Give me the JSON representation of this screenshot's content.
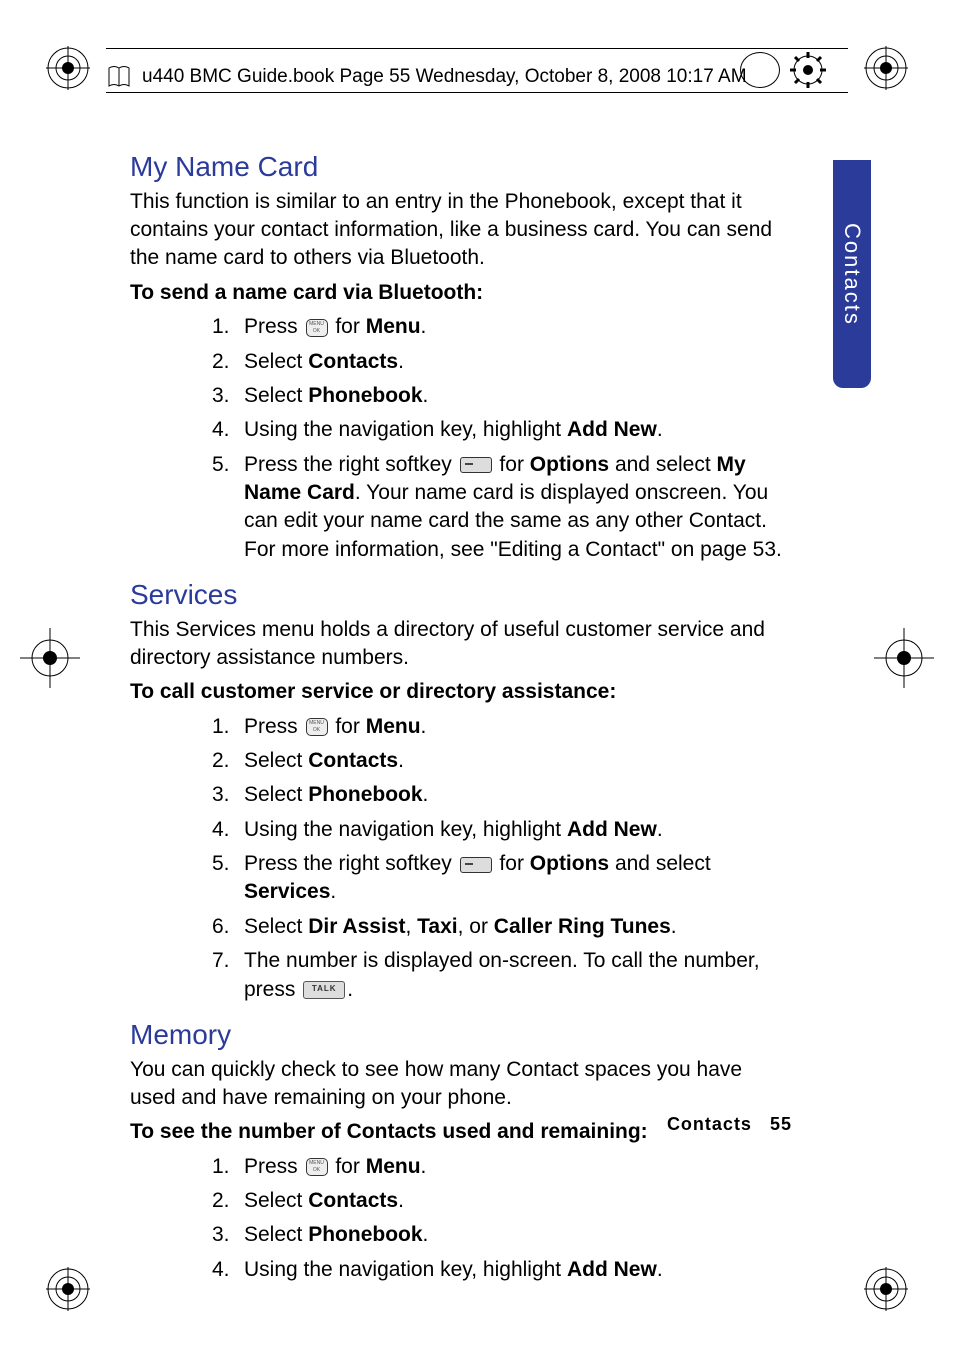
{
  "header": {
    "text": "u440 BMC Guide.book  Page 55  Wednesday, October 8, 2008  10:17 AM"
  },
  "sideTab": "Contacts",
  "sections": {
    "myNameCard": {
      "title": "My Name Card",
      "intro": "This function is similar to an entry in the Phonebook, except that it contains your contact information, like a business card. You can send the name card to others via Bluetooth.",
      "subhead": "To send a name card via Bluetooth:",
      "steps": {
        "s1_a": "Press ",
        "s1_b": " for ",
        "s1_menu": "Menu",
        "s1_c": ".",
        "s2_a": "Select ",
        "s2_b": "Contacts",
        "s2_c": ".",
        "s3_a": "Select ",
        "s3_b": "Phonebook",
        "s3_c": ".",
        "s4_a": "Using the navigation key, highlight ",
        "s4_b": "Add New",
        "s4_c": ".",
        "s5_a": "Press the right softkey ",
        "s5_b": " for ",
        "s5_opt": "Options",
        "s5_c": " and select ",
        "s5_mnc": "My Name Card",
        "s5_d": ". Your name card is displayed onscreen. You can edit your name card the same as any other Contact. For more information, see \"Editing a Contact\" on page 53."
      }
    },
    "services": {
      "title": "Services",
      "intro": "This Services menu holds a directory of useful customer service and directory assistance numbers.",
      "subhead": "To call customer service or directory assistance:",
      "steps": {
        "s1_a": "Press ",
        "s1_b": " for ",
        "s1_menu": "Menu",
        "s1_c": ".",
        "s2_a": "Select ",
        "s2_b": "Contacts",
        "s2_c": ".",
        "s3_a": "Select ",
        "s3_b": "Phonebook",
        "s3_c": ".",
        "s4_a": "Using the navigation key, highlight ",
        "s4_b": "Add New",
        "s4_c": ".",
        "s5_a": "Press the right softkey ",
        "s5_b": " for ",
        "s5_opt": "Options",
        "s5_c": " and select ",
        "s5_srv": "Services",
        "s5_d": ".",
        "s6_a": "Select ",
        "s6_b": "Dir Assist",
        "s6_c": ", ",
        "s6_d": "Taxi",
        "s6_e": ", or ",
        "s6_f": "Caller Ring Tunes",
        "s6_g": ".",
        "s7_a": "The number is displayed on-screen. To call the number, press ",
        "s7_b": "."
      }
    },
    "memory": {
      "title": "Memory",
      "intro": "You can quickly check to see how many Contact spaces you have used and have remaining on your phone.",
      "subhead": "To see the number of Contacts used and remaining:",
      "steps": {
        "s1_a": "Press ",
        "s1_b": " for ",
        "s1_menu": "Menu",
        "s1_c": ".",
        "s2_a": "Select ",
        "s2_b": "Contacts",
        "s2_c": ".",
        "s3_a": "Select ",
        "s3_b": "Phonebook",
        "s3_c": ".",
        "s4_a": "Using the navigation key, highlight ",
        "s4_b": "Add New",
        "s4_c": "."
      }
    }
  },
  "footer": {
    "label": "Contacts",
    "page": "55"
  }
}
